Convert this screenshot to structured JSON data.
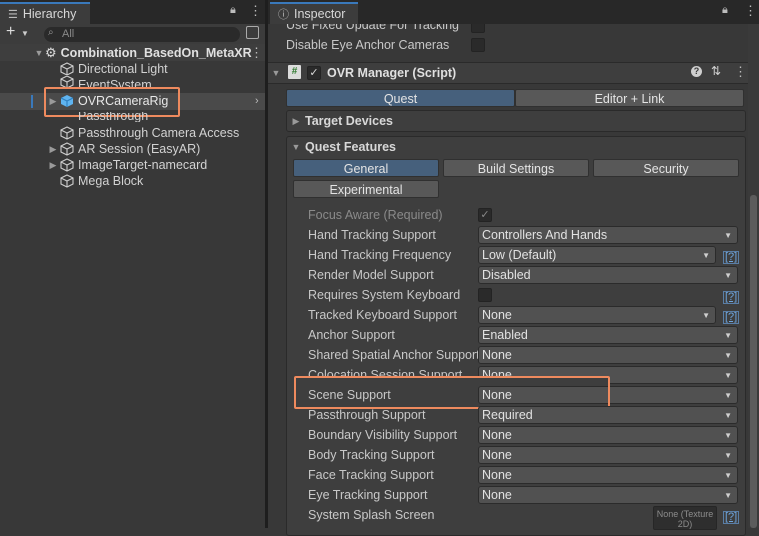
{
  "hierarchy": {
    "tab_title": "Hierarchy",
    "search_placeholder": "All",
    "scene_name": "Combination_BasedOn_MetaXR",
    "items": [
      {
        "label": "Directional Light"
      },
      {
        "label": "EventSystem"
      },
      {
        "label": "OVRCameraRig"
      },
      {
        "label": "Passthrough"
      },
      {
        "label": "Passthrough Camera Access"
      },
      {
        "label": "AR Session (EasyAR)"
      },
      {
        "label": "ImageTarget-namecard"
      },
      {
        "label": "Mega Block"
      }
    ]
  },
  "inspector": {
    "tab_title": "Inspector",
    "top_rows": [
      {
        "label": "Use Fixed Update For Tracking"
      },
      {
        "label": "Disable Eye Anchor Cameras"
      }
    ],
    "component_title": "OVR Manager (Script)",
    "platform_tabs": [
      "Quest",
      "Editor + Link"
    ],
    "target_devices": "Target Devices",
    "quest_features": "Quest Features",
    "feature_tabs": [
      "General",
      "Build Settings",
      "Security"
    ],
    "experimental_tab": "Experimental",
    "rows": [
      {
        "label": "Focus Aware (Required)",
        "value": "✓"
      },
      {
        "label": "Hand Tracking Support",
        "value": "Controllers And Hands"
      },
      {
        "label": "Hand Tracking Frequency",
        "value": "Low (Default)",
        "help": "[?]"
      },
      {
        "label": "Render Model Support",
        "value": "Disabled"
      },
      {
        "label": "Requires System Keyboard",
        "value": "",
        "help": "[?]"
      },
      {
        "label": "Tracked Keyboard Support",
        "value": "None",
        "help": "[?]"
      },
      {
        "label": "Anchor Support",
        "value": "Enabled"
      },
      {
        "label": "Shared Spatial Anchor Support",
        "value": "None"
      },
      {
        "label": "Colocation Session Support",
        "value": "None"
      },
      {
        "label": "Scene Support",
        "value": "None"
      },
      {
        "label": "Passthrough Support",
        "value": "Required"
      },
      {
        "label": "Boundary Visibility Support",
        "value": "None"
      },
      {
        "label": "Body Tracking Support",
        "value": "None"
      },
      {
        "label": "Face Tracking Support",
        "value": "None"
      },
      {
        "label": "Eye Tracking Support",
        "value": "None"
      },
      {
        "label": "System Splash Screen",
        "value": "None (Texture 2D)",
        "help": "[?]"
      }
    ]
  },
  "colors": {
    "highlight": "#ee8a5e",
    "active_tab": "#46607c",
    "selection": "#4a4a4a"
  }
}
